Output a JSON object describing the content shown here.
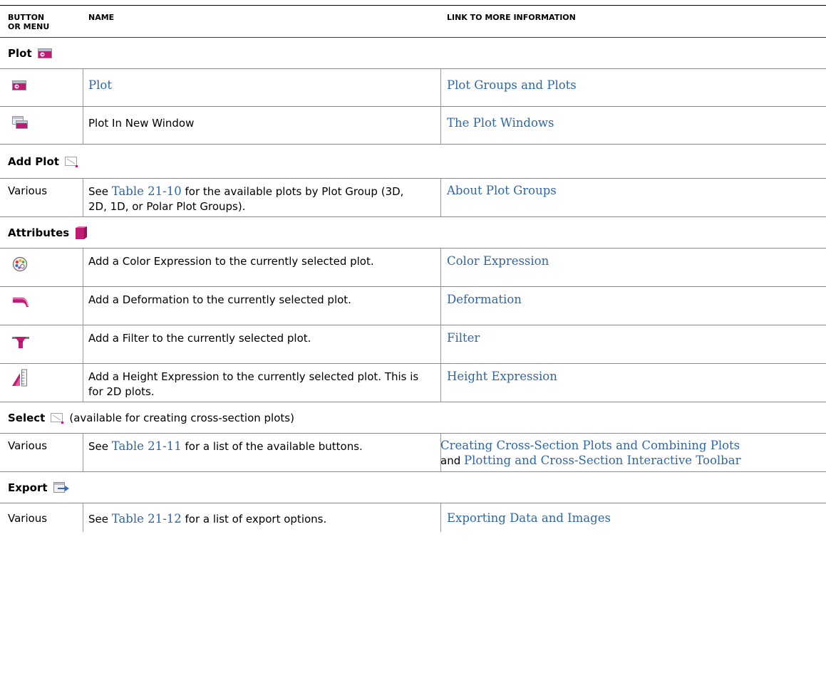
{
  "columns": {
    "button_or_menu": "BUTTON\nOR MENU",
    "name": "NAME",
    "link": "LINK TO MORE INFORMATION"
  },
  "sections": [
    {
      "title": "Plot",
      "icon": "plot-icon",
      "rows": [
        {
          "button": "",
          "icon": "plot-icon",
          "name": "Plot",
          "name_is_link": true,
          "link": "Plot Groups and Plots"
        },
        {
          "button": "",
          "icon": "plot-in-new-window-icon",
          "name": "Plot In New Window",
          "link": "The Plot Windows"
        }
      ]
    },
    {
      "title": "Add Plot",
      "icon": "add-plot-icon",
      "rows": [
        {
          "button": "Various",
          "name_prefix": "See ",
          "name_link": "Table 21-10",
          "name_suffix": " for the available plots by Plot Group (3D, 2D, 1D, or Polar Plot Groups).",
          "link": "About Plot Groups"
        }
      ]
    },
    {
      "title": "Attributes",
      "icon": "attributes-cube-icon",
      "rows": [
        {
          "icon": "color-expression-icon",
          "name": "Add a Color Expression to the currently selected plot.",
          "link": "Color Expression"
        },
        {
          "icon": "deformation-icon",
          "name": "Add a Deformation to the currently selected plot.",
          "link": "Deformation"
        },
        {
          "icon": "filter-icon",
          "name": "Add a Filter to the currently selected plot.",
          "link": "Filter"
        },
        {
          "icon": "height-expression-icon",
          "name": "Add a Height Expression to the currently selected plot. This is for 2D plots.",
          "link": "Height Expression"
        }
      ]
    },
    {
      "title": "Select",
      "note": "(available for creating cross-section plots)",
      "icon": "select-icon",
      "rows": [
        {
          "button": "Various",
          "name_prefix": "See ",
          "name_link": "Table 21-11",
          "name_suffix": " for a list of the available buttons.",
          "link": "Creating Cross-Section Plots and Combining Plots",
          "link_and": "and",
          "link2": "Plotting and Cross-Section Interactive Toolbar"
        }
      ]
    },
    {
      "title": "Export",
      "icon": "export-icon",
      "rows": [
        {
          "button": "Various",
          "name_prefix": "See ",
          "name_link": "Table 21-12",
          "name_suffix": " for a list of export options.",
          "link": "Exporting Data and Images"
        }
      ]
    }
  ],
  "colors": {
    "link": "#2f66a8",
    "accent_magenta": "#c01a72"
  }
}
